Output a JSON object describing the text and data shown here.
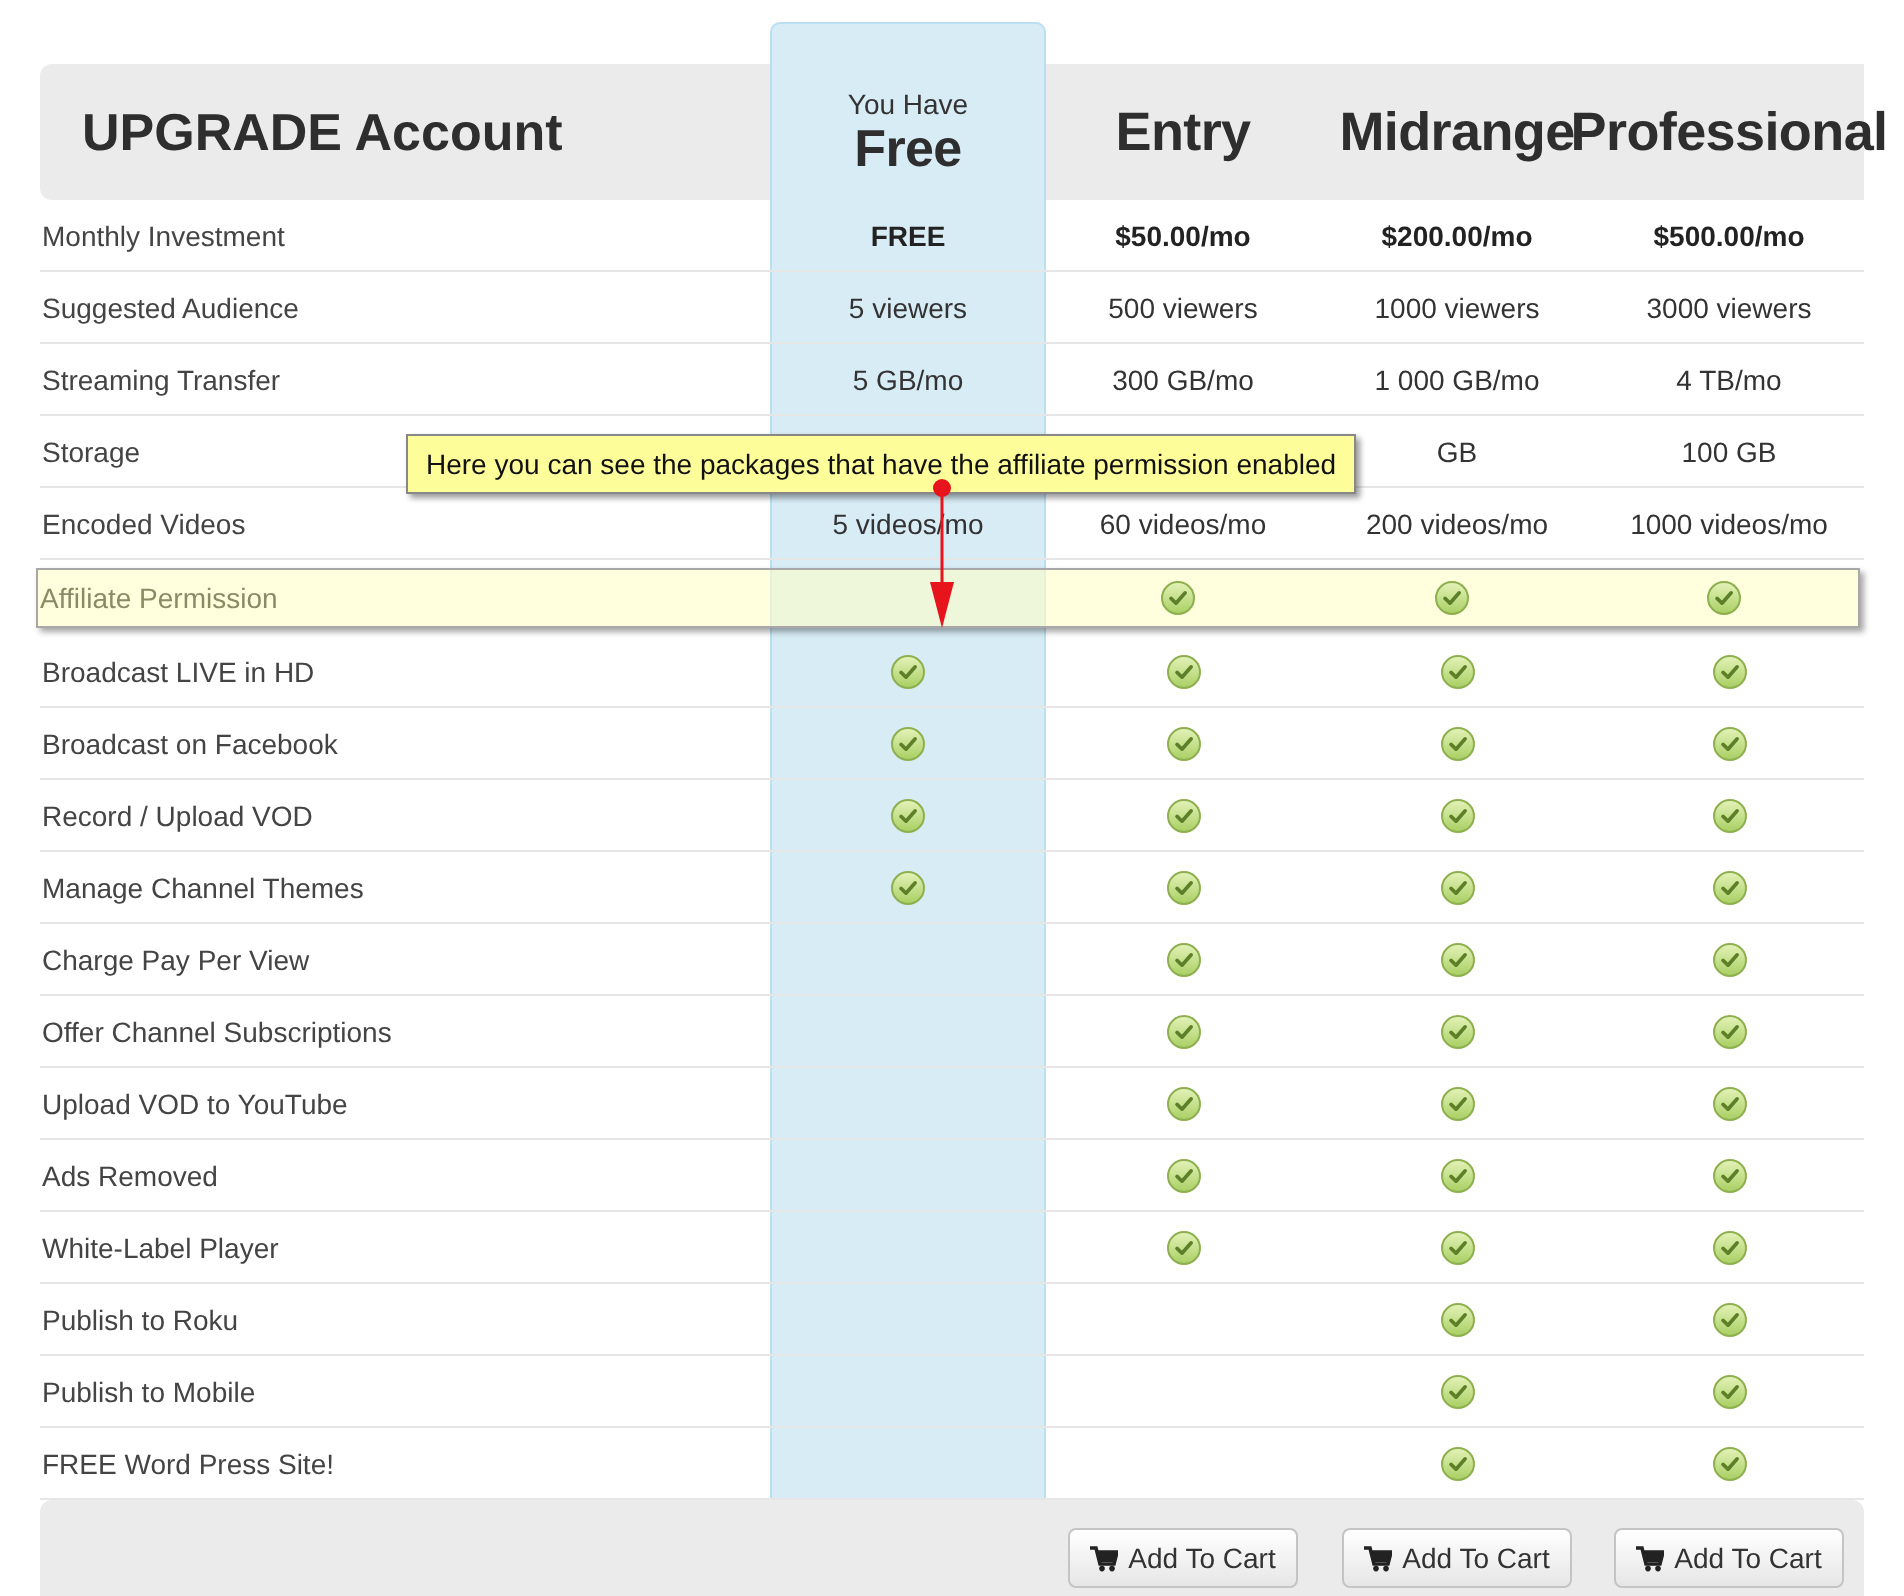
{
  "header": {
    "title": "UPGRADE Account",
    "plans": [
      {
        "name": "Free",
        "prefix": "You Have",
        "current": true
      },
      {
        "name": "Entry",
        "current": false
      },
      {
        "name": "Midrange",
        "current": false
      },
      {
        "name": "Professional",
        "current": false
      }
    ]
  },
  "rows": [
    {
      "kind": "price",
      "label": "Monthly Investment",
      "values": [
        "FREE",
        "$50.00/mo",
        "$200.00/mo",
        "$500.00/mo"
      ]
    },
    {
      "kind": "value",
      "label": "Suggested Audience",
      "values": [
        "5 viewers",
        "500 viewers",
        "1000 viewers",
        "3000 viewers"
      ]
    },
    {
      "kind": "value",
      "label": "Streaming Transfer",
      "values": [
        "5 GB/mo",
        "300 GB/mo",
        "1 000 GB/mo",
        "4 TB/mo"
      ]
    },
    {
      "kind": "value",
      "label": "Storage",
      "values": [
        "GB",
        "100 GB"
      ]
    },
    {
      "kind": "value",
      "label": "Encoded Videos",
      "values": [
        "5 videos/mo",
        "60 videos/mo",
        "200 videos/mo",
        "1000 videos/mo"
      ]
    },
    {
      "kind": "check",
      "label": "Affiliate Permission",
      "highlighted": true,
      "checks": [
        false,
        true,
        true,
        true
      ]
    },
    {
      "kind": "check",
      "label": "Broadcast LIVE in HD",
      "checks": [
        true,
        true,
        true,
        true
      ]
    },
    {
      "kind": "check",
      "label": "Broadcast on Facebook",
      "checks": [
        true,
        true,
        true,
        true
      ]
    },
    {
      "kind": "check",
      "label": "Record / Upload VOD",
      "checks": [
        true,
        true,
        true,
        true
      ]
    },
    {
      "kind": "check",
      "label": "Manage Channel Themes",
      "checks": [
        true,
        true,
        true,
        true
      ]
    },
    {
      "kind": "check",
      "label": "Charge Pay Per View",
      "checks": [
        false,
        true,
        true,
        true
      ]
    },
    {
      "kind": "check",
      "label": "Offer Channel Subscriptions",
      "checks": [
        false,
        true,
        true,
        true
      ]
    },
    {
      "kind": "check",
      "label": "Upload VOD to YouTube",
      "checks": [
        false,
        true,
        true,
        true
      ]
    },
    {
      "kind": "check",
      "label": "Ads Removed",
      "checks": [
        false,
        true,
        true,
        true
      ]
    },
    {
      "kind": "check",
      "label": "White-Label Player",
      "checks": [
        false,
        true,
        true,
        true
      ]
    },
    {
      "kind": "check",
      "label": "Publish to Roku",
      "checks": [
        false,
        false,
        true,
        true
      ]
    },
    {
      "kind": "check",
      "label": "Publish to Mobile",
      "checks": [
        false,
        false,
        true,
        true
      ]
    },
    {
      "kind": "check",
      "label": "FREE Word Press Site!",
      "checks": [
        false,
        false,
        true,
        true
      ]
    }
  ],
  "footer": {
    "buttons": [
      "Add To Cart",
      "Add To Cart",
      "Add To Cart"
    ]
  },
  "annotation": {
    "text": "Here you can see the packages that have the affiliate permission enabled"
  }
}
